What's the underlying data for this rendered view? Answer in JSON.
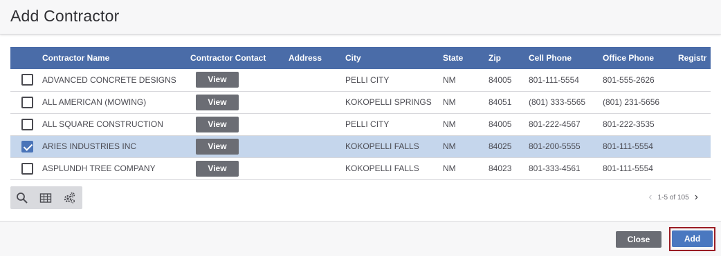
{
  "dialog": {
    "title": "Add Contractor"
  },
  "table": {
    "columns": [
      "",
      "Contractor Name",
      "Contractor Contact",
      "Address",
      "City",
      "State",
      "Zip",
      "Cell Phone",
      "Office Phone",
      "Registr"
    ],
    "view_label": "View",
    "rows": [
      {
        "checked": false,
        "name": "ADVANCED CONCRETE DESIGNS",
        "address": "",
        "city": "PELLI CITY",
        "state": "NM",
        "zip": "84005",
        "cell": "801-111-5554",
        "office": "801-555-2626"
      },
      {
        "checked": false,
        "name": "ALL AMERICAN (MOWING)",
        "address": "",
        "city": "KOKOPELLI SPRINGS",
        "state": "NM",
        "zip": "84051",
        "cell": "(801) 333-5565",
        "office": "(801) 231-5656"
      },
      {
        "checked": false,
        "name": "ALL SQUARE CONSTRUCTION",
        "address": "",
        "city": "PELLI CITY",
        "state": "NM",
        "zip": "84005",
        "cell": "801-222-4567",
        "office": "801-222-3535"
      },
      {
        "checked": true,
        "name": "ARIES INDUSTRIES INC",
        "address": "",
        "city": "KOKOPELLI FALLS",
        "state": "NM",
        "zip": "84025",
        "cell": "801-200-5555",
        "office": "801-111-5554"
      },
      {
        "checked": false,
        "name": "ASPLUNDH TREE COMPANY",
        "address": "",
        "city": "KOKOPELLI FALLS",
        "state": "NM",
        "zip": "84023",
        "cell": "801-333-4561",
        "office": "801-111-5554"
      }
    ]
  },
  "toolbar": {
    "icons": [
      "search-icon",
      "table-icon",
      "settings-gears-icon"
    ]
  },
  "pager": {
    "range_text": "1-5 of 105"
  },
  "footer": {
    "close_label": "Close",
    "add_label": "Add"
  },
  "colors": {
    "header_bar": "#4a6ca8",
    "selected_row": "#c5d6ec",
    "add_button": "#4a78c0",
    "close_button": "#6b6d74",
    "add_highlight": "#9a1c24"
  }
}
